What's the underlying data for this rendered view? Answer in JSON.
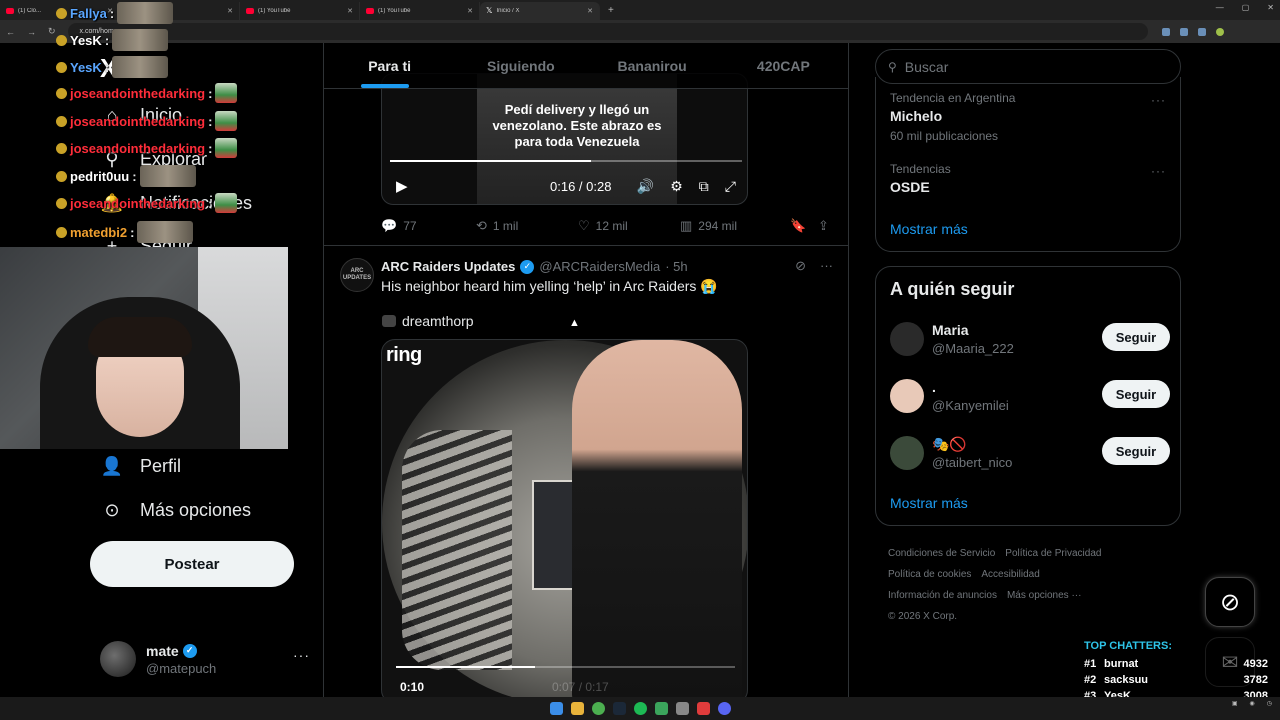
{
  "browser": {
    "tabs": [
      {
        "label": "(1) Clo...",
        "icon": "youtube-icon"
      },
      {
        "label": "(1) YouTube",
        "icon": "youtube-icon"
      },
      {
        "label": "(1) YouTube",
        "icon": "youtube-icon"
      },
      {
        "label": "(1) YouTube",
        "icon": "youtube-icon"
      },
      {
        "label": "Inicio / X",
        "icon": "x-icon"
      }
    ],
    "url": "x.com/home",
    "new_tab_label": "+"
  },
  "chat_overlay": [
    {
      "user": "Fallya",
      "color": "blue",
      "emote": "photo"
    },
    {
      "user": "YesK",
      "color": "white",
      "emote": "photo"
    },
    {
      "user": "YesK",
      "color": "blue",
      "emote": "photo"
    },
    {
      "user": "joseandointhedarking",
      "color": "red",
      "emote": "green"
    },
    {
      "user": "joseandointhedarking",
      "color": "red",
      "emote": "green"
    },
    {
      "user": "joseandointhedarking",
      "color": "red",
      "emote": "green"
    },
    {
      "user": "pedrit0uu",
      "color": "white",
      "emote": "photo"
    },
    {
      "user": "joseandointhedarking",
      "color": "red",
      "emote": "green"
    },
    {
      "user": "matedbi2",
      "color": "orange",
      "emote": "photo"
    }
  ],
  "sidebar": {
    "logo": "X",
    "items": [
      {
        "label": "Inicio",
        "icon": "home-icon"
      },
      {
        "label": "Explorar",
        "icon": "search-icon"
      },
      {
        "label": "Notificaciones",
        "icon": "bell-icon"
      },
      {
        "label": "Seguir",
        "icon": "follow-icon"
      },
      {
        "label": "Perfil",
        "icon": "person-icon"
      },
      {
        "label": "Más opciones",
        "icon": "more-circle-icon"
      }
    ],
    "post_label": "Postear",
    "profile": {
      "name": "mate",
      "handle": "@matepuch",
      "more": "···"
    }
  },
  "feed": {
    "tabs": [
      "Para ti",
      "Siguiendo",
      "Bananirou",
      "420CAP"
    ],
    "active_tab": 0,
    "tweet1": {
      "video_caption": "Pedí delivery y llegó un venezolano. Este abrazo es para toda Venezuela",
      "time": "0:16 / 0:28",
      "progress": 0.57,
      "replies": "77",
      "reposts": "1 mil",
      "likes": "12 mil",
      "views": "294 mil"
    },
    "tweet2": {
      "avatar_text": "ARC UPDATES",
      "name": "ARC Raiders Updates",
      "handle": "@ARCRaidersMedia",
      "time": "· 5h",
      "text": "His neighbor heard him yelling ‘help’ in Arc Raiders 😭",
      "credit": "dreamthorp",
      "video_brand": "ring",
      "video_time": "0:10",
      "video_faint_time": "0:07 / 0:17",
      "progress": 0.41
    }
  },
  "right": {
    "search_placeholder": "Buscar",
    "trends": [
      {
        "context": "Tendencia en Argentina",
        "title": "Michelo",
        "count": "60 mil publicaciones"
      },
      {
        "context": "Tendencias",
        "title": "OSDE",
        "count": ""
      }
    ],
    "trends_more": "Mostrar más",
    "who_title": "A quién seguir",
    "follow": [
      {
        "name": "Maria",
        "handle": "@Maaria_222",
        "button": "Seguir",
        "avatar_color": "#2a2a2a"
      },
      {
        "name": ".",
        "handle": "@Kanyemilei",
        "button": "Seguir",
        "avatar_color": "#e8c9b8"
      },
      {
        "name": "🎭🚫",
        "handle": "@taibert_nico",
        "button": "Seguir",
        "avatar_color": "#3b4a3a"
      }
    ],
    "who_more": "Mostrar más",
    "footer": [
      "Condiciones de Servicio",
      "Política de Privacidad",
      "Política de cookies",
      "Accesibilidad",
      "Información de anuncios",
      "Más opciones ···",
      "© 2026 X Corp."
    ]
  },
  "top_chatters": {
    "title": "TOP CHATTERS:",
    "rows": [
      {
        "rank": "#1",
        "name": "burnat",
        "count": "4932"
      },
      {
        "rank": "#2",
        "name": "sacksuu",
        "count": "3782"
      },
      {
        "rank": "#3",
        "name": "YesK",
        "count": "3008"
      }
    ]
  }
}
